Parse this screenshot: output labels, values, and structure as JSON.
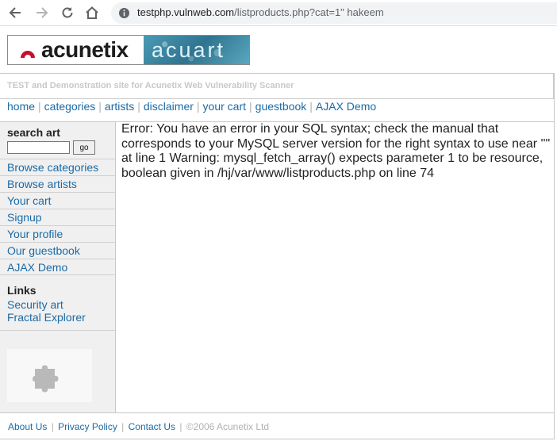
{
  "browser": {
    "url_host": "testphp.vulnweb.com",
    "url_rest": "/listproducts.php?cat=1\" hakeem",
    "back_icon": "back-arrow-icon",
    "forward_icon": "forward-arrow-icon",
    "reload_icon": "reload-icon",
    "home_icon": "home-icon",
    "info_icon": "site-info-icon"
  },
  "header": {
    "logo_text": "acunetix",
    "logo_right_text": "acuart",
    "tagline": "TEST and Demonstration site for Acunetix Web Vulnerability Scanner",
    "brand_color": "#c8102e"
  },
  "topnav": {
    "items": [
      "home",
      "categories",
      "artists",
      "disclaimer",
      "your cart",
      "guestbook",
      "AJAX Demo"
    ]
  },
  "sidebar": {
    "search_title": "search art",
    "search_value": "",
    "search_button": "go",
    "items": [
      "Browse categories",
      "Browse artists",
      "Your cart",
      "Signup",
      "Your profile",
      "Our guestbook",
      "AJAX Demo"
    ],
    "links_title": "Links",
    "links": [
      "Security art",
      "Fractal Explorer"
    ],
    "plugin_icon": "puzzle-piece-icon"
  },
  "main": {
    "error_text": "Error: You have an error in your SQL syntax; check the manual that corresponds to your MySQL server version for the right syntax to use near '\"' at line 1 Warning: mysql_fetch_array() expects parameter 1 to be resource, boolean given in /hj/var/www/listproducts.php on line 74"
  },
  "footer": {
    "links": [
      "About Us",
      "Privacy Policy",
      "Contact Us"
    ],
    "copyright": "©2006 Acunetix Ltd"
  },
  "colors": {
    "link": "#1b6aa5",
    "sidebar_bg": "#f0f0f0",
    "muted": "#c8c8c8"
  }
}
